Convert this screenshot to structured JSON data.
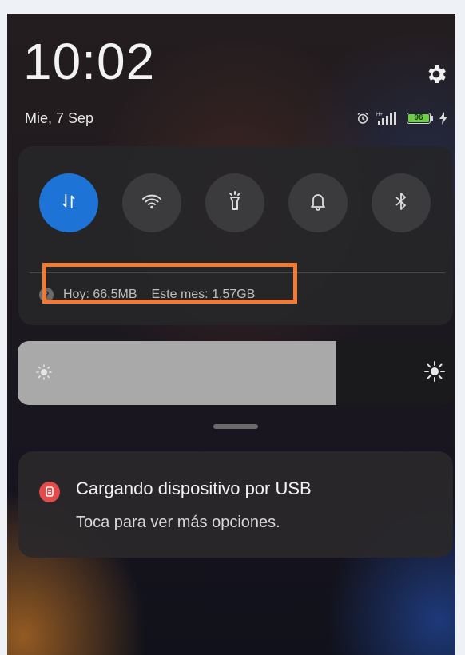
{
  "lockscreen": {
    "time": "10:02",
    "date": "Mie, 7 Sep"
  },
  "status": {
    "battery_level": "96",
    "icons": [
      "alarm-icon",
      "signal-icon",
      "battery-icon",
      "charging-icon"
    ]
  },
  "quick_settings": {
    "tiles": [
      {
        "name": "mobile-data-tile",
        "icon": "data-arrows-icon",
        "active": true
      },
      {
        "name": "wifi-tile",
        "icon": "wifi-icon",
        "active": false
      },
      {
        "name": "flashlight-tile",
        "icon": "flashlight-icon",
        "active": false
      },
      {
        "name": "sound-tile",
        "icon": "bell-icon",
        "active": false
      },
      {
        "name": "bluetooth-tile",
        "icon": "bluetooth-icon",
        "active": false
      }
    ],
    "data_usage": {
      "today": "Hoy: 66,5MB",
      "month": "Este mes: 1,57GB"
    },
    "active_color": "#1e74d6",
    "highlight_color": "#f07a36"
  },
  "brightness": {
    "level": 0.73
  },
  "notification": {
    "title": "Cargando dispositivo por USB",
    "subtitle": "Toca para ver más opciones.",
    "icon": "usb-charging-icon",
    "icon_color": "#e24b4b"
  }
}
